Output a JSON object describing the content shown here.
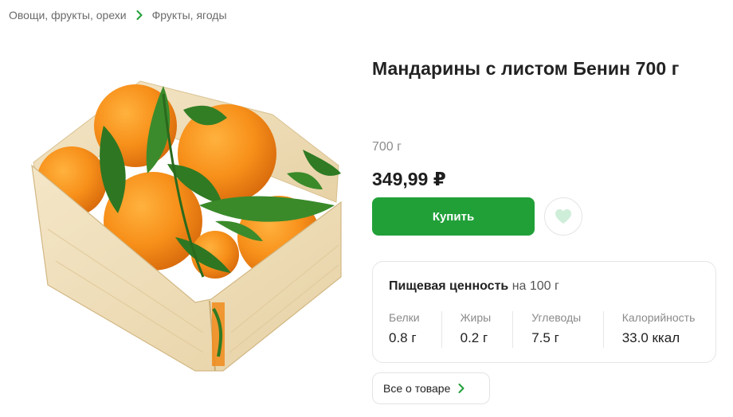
{
  "breadcrumb": {
    "items": [
      {
        "label": "Овощи, фрукты, орехи"
      },
      {
        "label": "Фрукты, ягоды"
      }
    ]
  },
  "product": {
    "title": "Мандарины с листом Бенин 700 г",
    "weight": "700 г",
    "price": "349,99 ₽",
    "buy_label": "Купить"
  },
  "nutrition": {
    "title": "Пищевая ценность",
    "per": "на 100 г",
    "items": [
      {
        "label": "Белки",
        "value": "0.8 г"
      },
      {
        "label": "Жиры",
        "value": "0.2 г"
      },
      {
        "label": "Углеводы",
        "value": "7.5 г"
      },
      {
        "label": "Калорийность",
        "value": "33.0 ккал"
      }
    ]
  },
  "about": {
    "label": "Все о товаре"
  },
  "colors": {
    "accent": "#21a038",
    "heart": "#cfeed9",
    "chevron": "#21a038"
  },
  "icons": {
    "breadcrumb_separator": "chevron-right-icon",
    "favorite": "heart-icon",
    "about_arrow": "chevron-right-icon"
  }
}
